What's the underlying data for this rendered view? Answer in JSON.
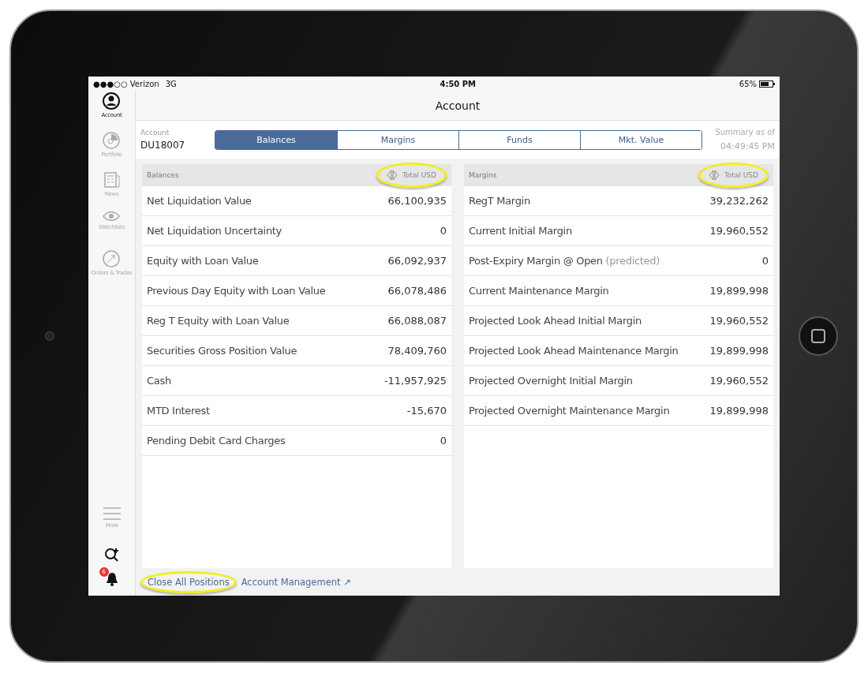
{
  "status_bar": {
    "carrier": "●●●○○ Verizon",
    "network": "3G",
    "time": "4:50 PM",
    "battery": "65%"
  },
  "sidebar": {
    "items": [
      {
        "label": "Account",
        "selected": true
      },
      {
        "label": "Portfolio",
        "selected": false
      },
      {
        "label": "News",
        "selected": false
      },
      {
        "label": "Watchlists",
        "selected": false
      },
      {
        "label": "Orders & Trades",
        "selected": false
      }
    ],
    "more": "More",
    "alerts_badge": "6"
  },
  "header": {
    "title": "Account"
  },
  "account": {
    "label": "Account",
    "id": "DU18007"
  },
  "tabs": [
    {
      "label": "Balances",
      "selected": true
    },
    {
      "label": "Margins",
      "selected": false
    },
    {
      "label": "Funds",
      "selected": false
    },
    {
      "label": "Mkt. Value",
      "selected": false
    }
  ],
  "summary": {
    "label": "Summary as of",
    "time": "04:49:45 PM"
  },
  "panels": [
    {
      "title": "Balances",
      "currency": "Total USD",
      "highlighted": true,
      "rows": [
        {
          "label": "Net Liquidation Value",
          "value": "66,100,935"
        },
        {
          "label": "Net Liquidation Uncertainty",
          "value": "0"
        },
        {
          "label": "Equity with Loan Value",
          "value": "66,092,937"
        },
        {
          "label": "Previous Day Equity with Loan Value",
          "value": "66,078,486"
        },
        {
          "label": "Reg T Equity with Loan Value",
          "value": "66,088,087"
        },
        {
          "label": "Securities Gross Position Value",
          "value": "78,409,760"
        },
        {
          "label": "Cash",
          "value": "-11,957,925"
        },
        {
          "label": "MTD Interest",
          "value": "-15,670"
        },
        {
          "label": "Pending Debit Card Charges",
          "value": "0"
        }
      ]
    },
    {
      "title": "Margins",
      "currency": "Total USD",
      "highlighted": true,
      "rows": [
        {
          "label": "RegT Margin",
          "value": "39,232,262"
        },
        {
          "label": "Current Initial Margin",
          "value": "19,960,552"
        },
        {
          "label": "Post-Expiry Margin @ Open",
          "note": "(predicted)",
          "value": "0"
        },
        {
          "label": "Current Maintenance Margin",
          "value": "19,899,998"
        },
        {
          "label": "Projected Look Ahead Initial Margin",
          "value": "19,960,552"
        },
        {
          "label": "Projected Look Ahead Maintenance Margin",
          "value": "19,899,998"
        },
        {
          "label": "Projected Overnight Initial Margin",
          "value": "19,960,552"
        },
        {
          "label": "Projected Overnight Maintenance Margin",
          "value": "19,899,998"
        }
      ]
    }
  ],
  "footer": {
    "links": [
      {
        "label": "Close All Positions",
        "highlighted": true
      },
      {
        "label": "Account Management ↗",
        "highlighted": false
      }
    ]
  }
}
